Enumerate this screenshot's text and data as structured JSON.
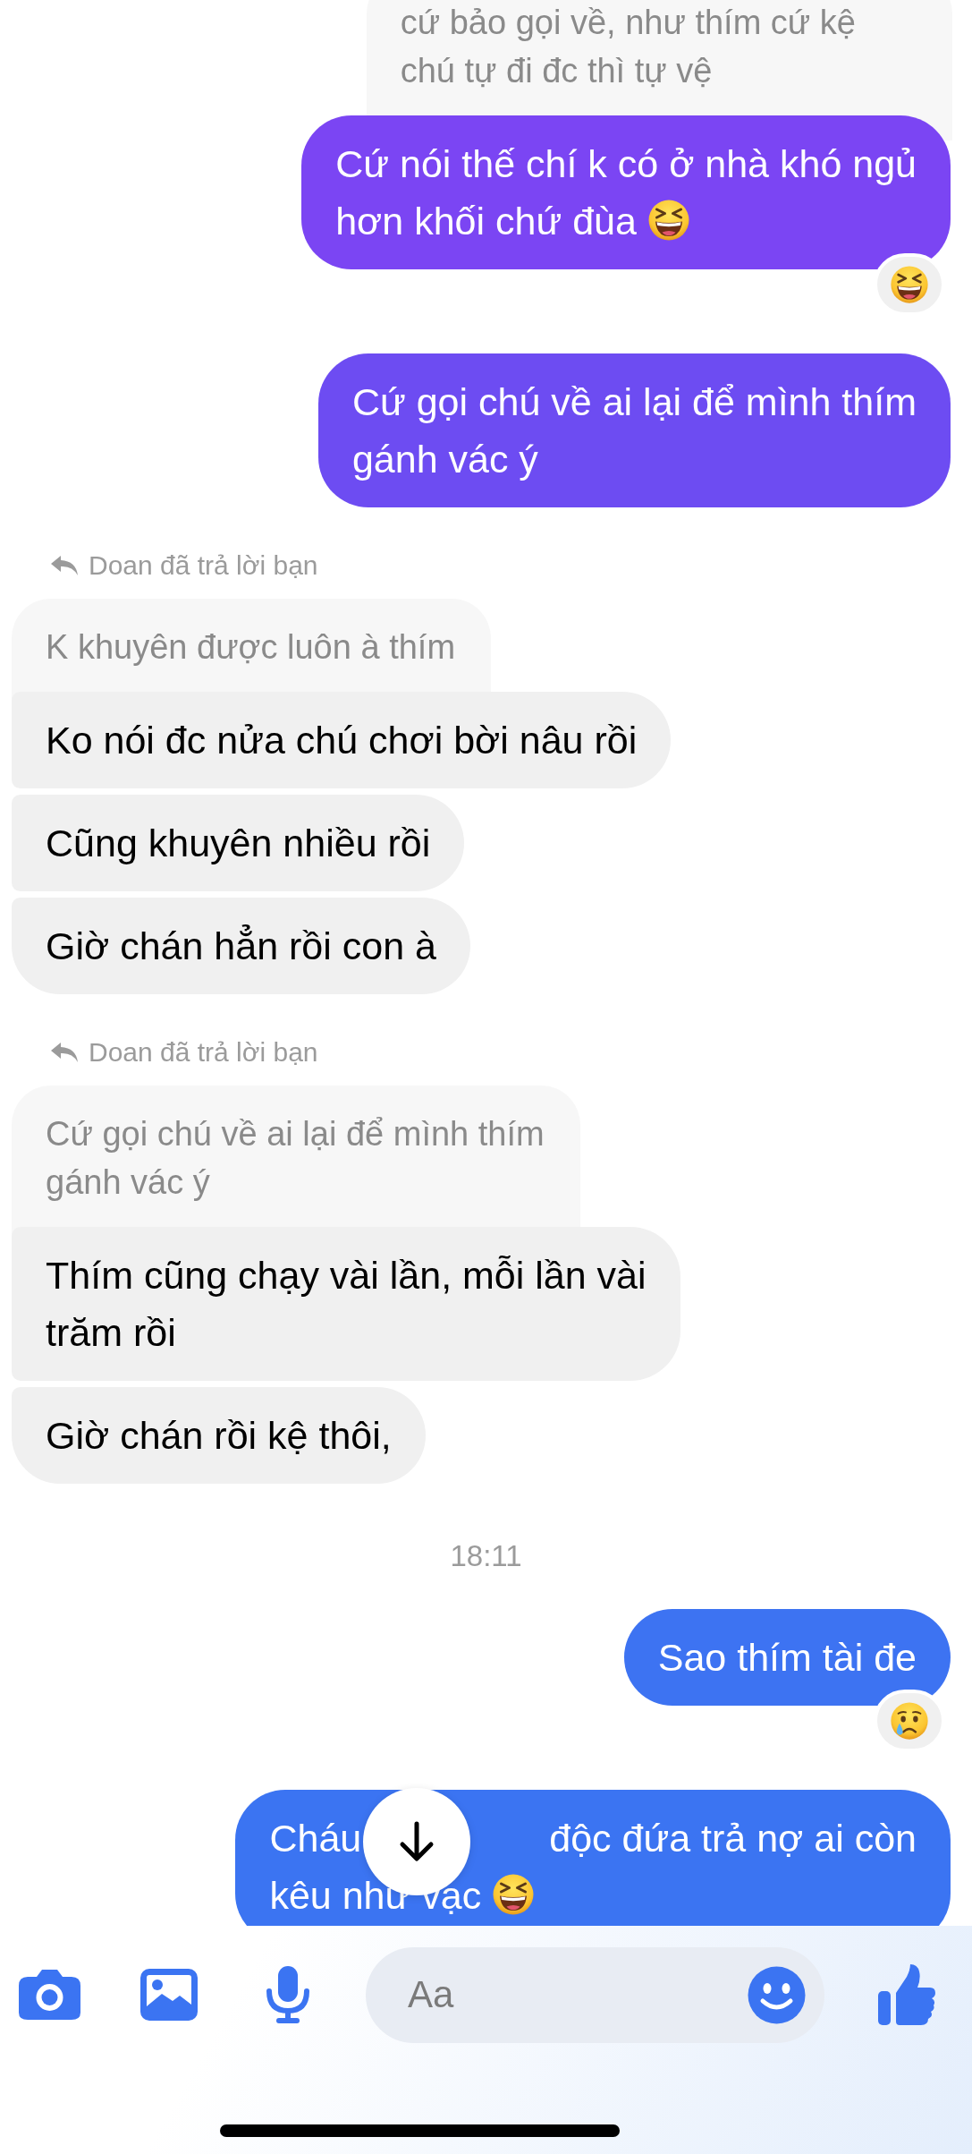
{
  "messages": [
    {
      "kind": "quote",
      "from_me": true,
      "lines": [
        "cứ bảo gọi về, như thím cứ kệ",
        "chú tự đi đc thì tự vệ"
      ]
    },
    {
      "kind": "outgoing",
      "color": "#7b45f3",
      "lines": [
        "Cứ nói thế chí k có ở nhà khó ngủ",
        "hơn khối chứ đùa"
      ],
      "trailing_emoji": {
        "kind": "laughing"
      },
      "reaction": {
        "kind": "laughing"
      }
    },
    {
      "kind": "outgoing",
      "color": "#6d4cf2",
      "lines": [
        "Cứ gọi chú về ai lại để mình thím",
        "gánh vác ý"
      ]
    },
    {
      "kind": "reply_label",
      "text": "Doan đã trả lời bạn"
    },
    {
      "kind": "quote",
      "from_me": false,
      "lines": [
        "K khuyên được luôn à thím"
      ]
    },
    {
      "kind": "incoming",
      "lines": [
        "Ko nói đc nửa chú chơi bời nâu rồi"
      ]
    },
    {
      "kind": "incoming",
      "lines": [
        "Cũng khuyên nhiều rồi"
      ]
    },
    {
      "kind": "incoming",
      "lines": [
        "Giờ chán hẳn rồi con à"
      ]
    },
    {
      "kind": "reply_label",
      "text": "Doan đã trả lời bạn"
    },
    {
      "kind": "quote",
      "from_me": false,
      "lines": [
        "Cứ gọi chú về ai lại để mình thím",
        "gánh vác ý"
      ]
    },
    {
      "kind": "incoming",
      "lines": [
        "Thím cũng chạy vài lần, mỗi lần vài",
        "trăm rồi"
      ]
    },
    {
      "kind": "incoming",
      "lines": [
        "Giờ chán rồi kệ thôi,"
      ]
    },
    {
      "kind": "timestamp",
      "text": "18:11"
    },
    {
      "kind": "outgoing",
      "color": "#3d73f2",
      "lines": [
        "Sao thím tài đe"
      ],
      "reaction": {
        "kind": "crying"
      }
    },
    {
      "kind": "outgoing",
      "color": "#3b74f2",
      "lines": [
        [
          "Cháu",
          "độc đứa trả nợ ai còn"
        ],
        "kêu như vạc"
      ],
      "trailing_emoji": {
        "kind": "laughing"
      }
    }
  ],
  "composer": {
    "placeholder": "Aa"
  }
}
